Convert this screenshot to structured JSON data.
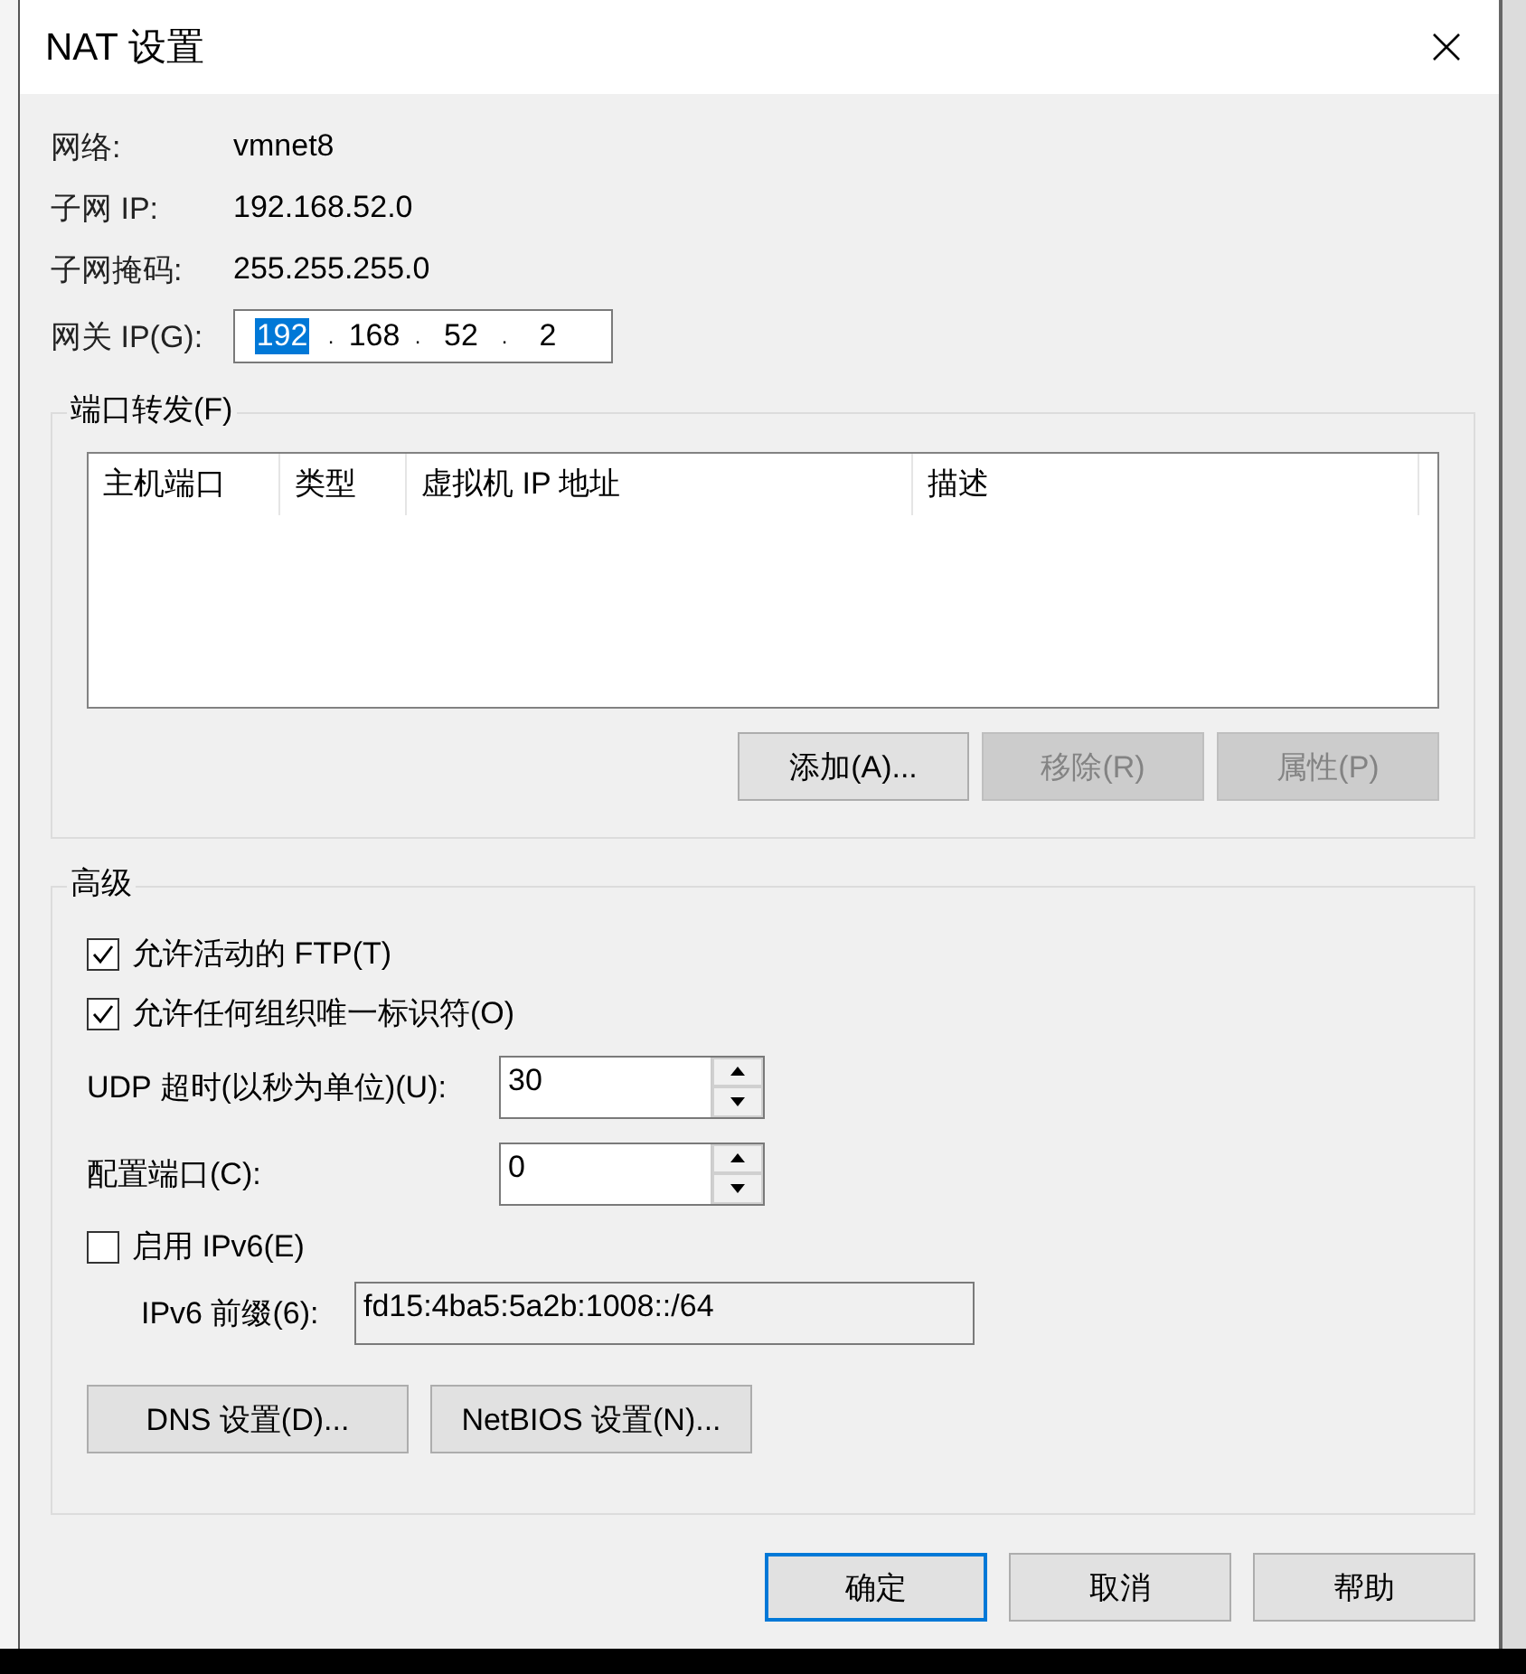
{
  "window": {
    "title": "NAT 设置"
  },
  "info": [
    {
      "label": "网络:",
      "value": "vmnet8"
    },
    {
      "label": "子网 IP:",
      "value": "192.168.52.0"
    },
    {
      "label": "子网掩码:",
      "value": "255.255.255.0"
    }
  ],
  "gateway": {
    "label": "网关 IP(G):",
    "separator": ".",
    "octets": [
      {
        "value": "192",
        "selected": true
      },
      {
        "value": "168",
        "selected": false
      },
      {
        "value": "52",
        "selected": false
      },
      {
        "value": "2",
        "selected": false
      }
    ]
  },
  "port_forwarding": {
    "title": "端口转发(F)",
    "columns": [
      "主机端口",
      "类型",
      "虚拟机 IP 地址",
      "描述"
    ],
    "buttons": [
      {
        "label": "添加(A)...",
        "disabled": false
      },
      {
        "label": "移除(R)",
        "disabled": true
      },
      {
        "label": "属性(P)",
        "disabled": true
      }
    ]
  },
  "advanced": {
    "title": "高级",
    "options": [
      {
        "kind": "checkbox",
        "label": "允许活动的 FTP(T)",
        "checked": true
      },
      {
        "kind": "checkbox",
        "label": "允许任何组织唯一标识符(O)",
        "checked": true
      },
      {
        "kind": "spin",
        "label": "UDP 超时(以秒为单位)(U):",
        "value": "30"
      },
      {
        "kind": "spin",
        "label": "配置端口(C):",
        "value": "0"
      },
      {
        "kind": "checkbox",
        "label": "启用 IPv6(E)",
        "checked": false
      },
      {
        "kind": "field",
        "label": "IPv6 前缀(6):",
        "value": "fd15:4ba5:5a2b:1008::/64",
        "disabled": true
      }
    ],
    "buttons": [
      {
        "label": "DNS 设置(D)...",
        "disabled": false
      },
      {
        "label": "NetBIOS 设置(N)...",
        "disabled": false
      }
    ]
  },
  "footer_buttons": [
    {
      "label": "确定",
      "default": true
    },
    {
      "label": "取消",
      "default": false
    },
    {
      "label": "帮助",
      "default": false
    }
  ]
}
